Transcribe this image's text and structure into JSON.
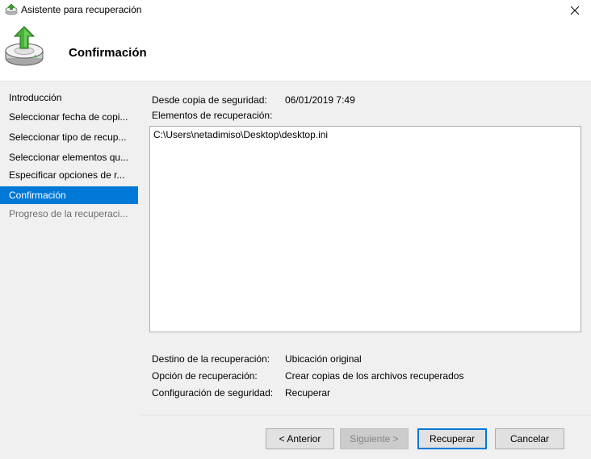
{
  "window": {
    "title": "Asistente para recuperación"
  },
  "header": {
    "title": "Confirmación"
  },
  "sidebar": {
    "items": [
      {
        "label": "Introducción",
        "state": "normal"
      },
      {
        "label": "Seleccionar fecha de copi...",
        "state": "normal"
      },
      {
        "label": "Seleccionar tipo de recup...",
        "state": "normal"
      },
      {
        "label": "Seleccionar elementos qu...",
        "state": "normal"
      },
      {
        "label": "Especificar opciones de r...",
        "state": "normal"
      },
      {
        "label": "Confirmación",
        "state": "active"
      },
      {
        "label": "Progreso de la recuperaci...",
        "state": "disabled"
      }
    ]
  },
  "main": {
    "backup_label": "Desde copia de seguridad:",
    "backup_value": "06/01/2019 7:49",
    "items_label": "Elementos de recuperación:",
    "items": [
      "C:\\Users\\netadimiso\\Desktop\\desktop.ini"
    ],
    "destination_label": "Destino de la recuperación:",
    "destination_value": "Ubicación original",
    "option_label": "Opción de recuperación:",
    "option_value": "Crear copias de los archivos recuperados",
    "security_label": "Configuración de seguridad:",
    "security_value": "Recuperar"
  },
  "buttons": {
    "back": "< Anterior",
    "next": "Siguiente >",
    "recover": "Recuperar",
    "cancel": "Cancelar"
  },
  "colors": {
    "accent": "#0078d7",
    "panel": "#f0f0f0",
    "disabled_text": "#6d6d6d"
  }
}
